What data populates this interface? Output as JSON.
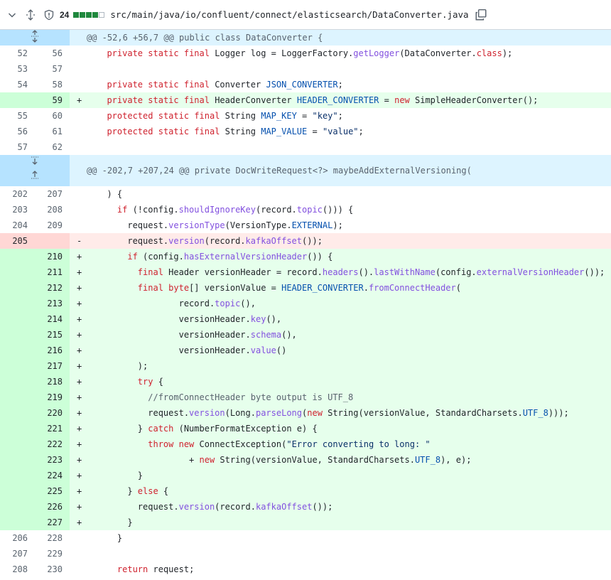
{
  "header": {
    "changes_count": "24",
    "file_path": "src/main/java/io/confluent/connect/elasticsearch/DataConverter.java",
    "diffstat": [
      "add",
      "add",
      "add",
      "add",
      "neutral"
    ]
  },
  "hunks": [
    {
      "text": "@@ -52,6 +56,7 @@ public class DataConverter {"
    },
    {
      "text": "@@ -202,7 +207,24 @@ private DocWriteRequest<?> maybeAddExternalVersioning("
    }
  ],
  "lines": [
    {
      "type": "ctx",
      "old": "52",
      "new": "56",
      "sign": "",
      "code": "  private static final Logger log = LoggerFactory.getLogger(DataConverter.class);"
    },
    {
      "type": "ctx",
      "old": "53",
      "new": "57",
      "sign": "",
      "code": ""
    },
    {
      "type": "ctx",
      "old": "54",
      "new": "58",
      "sign": "",
      "code": "  private static final Converter JSON_CONVERTER;"
    },
    {
      "type": "add",
      "old": "",
      "new": "59",
      "sign": "+",
      "code": "  private static final HeaderConverter HEADER_CONVERTER = new SimpleHeaderConverter();"
    },
    {
      "type": "ctx",
      "old": "55",
      "new": "60",
      "sign": "",
      "code": "  protected static final String MAP_KEY = \"key\";"
    },
    {
      "type": "ctx",
      "old": "56",
      "new": "61",
      "sign": "",
      "code": "  protected static final String MAP_VALUE = \"value\";"
    },
    {
      "type": "ctx",
      "old": "57",
      "new": "62",
      "sign": "",
      "code": ""
    },
    {
      "type": "ctx",
      "old": "202",
      "new": "207",
      "sign": "",
      "code": "  ) {"
    },
    {
      "type": "ctx",
      "old": "203",
      "new": "208",
      "sign": "",
      "code": "    if (!config.shouldIgnoreKey(record.topic())) {"
    },
    {
      "type": "ctx",
      "old": "204",
      "new": "209",
      "sign": "",
      "code": "      request.versionType(VersionType.EXTERNAL);"
    },
    {
      "type": "del",
      "old": "205",
      "new": "",
      "sign": "-",
      "code": "      request.version(record.kafkaOffset());"
    },
    {
      "type": "add",
      "old": "",
      "new": "210",
      "sign": "+",
      "code": "      if (config.hasExternalVersionHeader()) {"
    },
    {
      "type": "add",
      "old": "",
      "new": "211",
      "sign": "+",
      "code": "        final Header versionHeader = record.headers().lastWithName(config.externalVersionHeader());"
    },
    {
      "type": "add",
      "old": "",
      "new": "212",
      "sign": "+",
      "code": "        final byte[] versionValue = HEADER_CONVERTER.fromConnectHeader("
    },
    {
      "type": "add",
      "old": "",
      "new": "213",
      "sign": "+",
      "code": "                record.topic(),"
    },
    {
      "type": "add",
      "old": "",
      "new": "214",
      "sign": "+",
      "code": "                versionHeader.key(),"
    },
    {
      "type": "add",
      "old": "",
      "new": "215",
      "sign": "+",
      "code": "                versionHeader.schema(),"
    },
    {
      "type": "add",
      "old": "",
      "new": "216",
      "sign": "+",
      "code": "                versionHeader.value()"
    },
    {
      "type": "add",
      "old": "",
      "new": "217",
      "sign": "+",
      "code": "        );"
    },
    {
      "type": "add",
      "old": "",
      "new": "218",
      "sign": "+",
      "code": "        try {"
    },
    {
      "type": "add",
      "old": "",
      "new": "219",
      "sign": "+",
      "code": "          //fromConnectHeader byte output is UTF_8"
    },
    {
      "type": "add",
      "old": "",
      "new": "220",
      "sign": "+",
      "code": "          request.version(Long.parseLong(new String(versionValue, StandardCharsets.UTF_8)));"
    },
    {
      "type": "add",
      "old": "",
      "new": "221",
      "sign": "+",
      "code": "        } catch (NumberFormatException e) {"
    },
    {
      "type": "add",
      "old": "",
      "new": "222",
      "sign": "+",
      "code": "          throw new ConnectException(\"Error converting to long: \""
    },
    {
      "type": "add",
      "old": "",
      "new": "223",
      "sign": "+",
      "code": "                  + new String(versionValue, StandardCharsets.UTF_8), e);"
    },
    {
      "type": "add",
      "old": "",
      "new": "224",
      "sign": "+",
      "code": "        }"
    },
    {
      "type": "add",
      "old": "",
      "new": "225",
      "sign": "+",
      "code": "      } else {"
    },
    {
      "type": "add",
      "old": "",
      "new": "226",
      "sign": "+",
      "code": "        request.version(record.kafkaOffset());"
    },
    {
      "type": "add",
      "old": "",
      "new": "227",
      "sign": "+",
      "code": "      }"
    },
    {
      "type": "ctx",
      "old": "206",
      "new": "228",
      "sign": "",
      "code": "    }"
    },
    {
      "type": "ctx",
      "old": "207",
      "new": "229",
      "sign": "",
      "code": ""
    },
    {
      "type": "ctx",
      "old": "208",
      "new": "230",
      "sign": "",
      "code": "    return request;"
    }
  ]
}
